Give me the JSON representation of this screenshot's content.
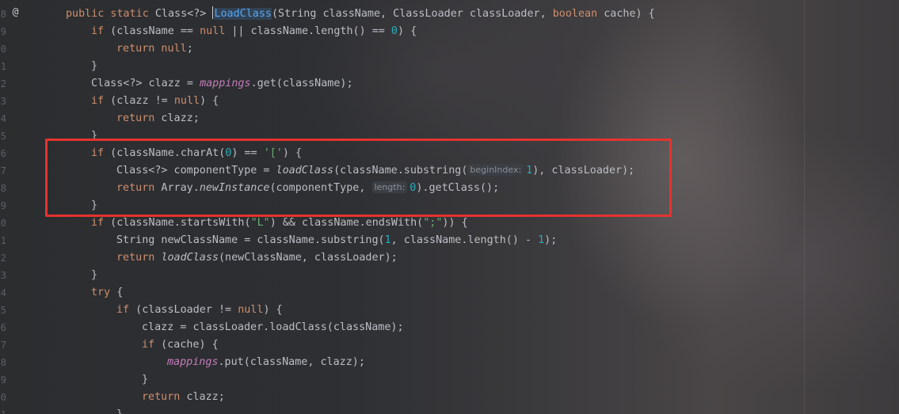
{
  "gutter": {
    "line_numbers": [
      "8",
      "9",
      "0",
      "1",
      "2",
      "3",
      "4",
      "5",
      "6",
      "7",
      "8",
      "9",
      "0",
      "1",
      "2",
      "3",
      "4",
      "5",
      "6",
      "7",
      "8",
      "9",
      "0",
      "1"
    ],
    "marker": "@"
  },
  "code": {
    "l1": {
      "kw1": "public static",
      "t1": " Class<?> ",
      "fn": "LoadClass",
      "t2": "(String className, ClassLoader classLoader, ",
      "kw2": "boolean",
      "t3": " cache) {"
    },
    "l2": {
      "kw1": "if",
      "t1": " (className == ",
      "kw2": "null",
      "t2": " || className.length() == ",
      "n1": "0",
      "t3": ") {"
    },
    "l3": {
      "kw1": "return null",
      "t1": ";"
    },
    "l4": {
      "t1": "}"
    },
    "l5": {
      "t1": "Class<?> clazz = ",
      "f1": "mappings",
      "t2": ".get(className);"
    },
    "l6": {
      "kw1": "if",
      "t1": " (clazz != ",
      "kw2": "null",
      "t2": ") {"
    },
    "l7": {
      "kw1": "return",
      "t1": " clazz;"
    },
    "l8": {
      "t1": "}"
    },
    "l9": {
      "kw1": "if",
      "t1": " (className.charAt(",
      "n1": "0",
      "t2": ") == ",
      "s1": "'['",
      "t3": ") {"
    },
    "l10": {
      "t1": "Class<?> componentType = ",
      "i1": "loadClass",
      "t2": "(className.substring(",
      "h1": "beginIndex:",
      "n1": "1",
      "t3": "), classLoader);"
    },
    "l11": {
      "kw1": "return",
      "t1": " Array.",
      "i1": "newInstance",
      "t2": "(componentType, ",
      "h1": "length:",
      "n1": "0",
      "t3": ").getClass();"
    },
    "l12": {
      "t1": "}"
    },
    "l13": {
      "kw1": "if",
      "t1": " (className.startsWith(",
      "s1": "\"L\"",
      "t2": ") && className.endsWith(",
      "s2": "\";\"",
      "t3": ")) {"
    },
    "l14": {
      "t1": "String newClassName = className.substring(",
      "n1": "1",
      "t2": ", className.length() - ",
      "n2": "1",
      "t3": ");"
    },
    "l15": {
      "kw1": "return",
      "t1": " ",
      "i1": "loadClass",
      "t2": "(newClassName, classLoader);"
    },
    "l16": {
      "t1": "}"
    },
    "l17": {
      "kw1": "try",
      "t1": " {"
    },
    "l18": {
      "kw1": "if",
      "t1": " (classLoader != ",
      "kw2": "null",
      "t2": ") {"
    },
    "l19": {
      "t1": "clazz = classLoader.loadClass(className);"
    },
    "l20": {
      "kw1": "if",
      "t1": " (cache) {"
    },
    "l21": {
      "f1": "mappings",
      "t1": ".put(className, clazz);"
    },
    "l22": {
      "t1": "}"
    },
    "l23": {
      "kw1": "return",
      "t1": " clazz;"
    },
    "l24": {
      "t1": "}"
    }
  },
  "colors": {
    "keyword": "#cf8e6d",
    "method": "#56a8f5",
    "number": "#2aacb8",
    "string": "#6aab73",
    "field": "#c77dbb",
    "text": "#bcbec4",
    "annotation_box": "#e5332e"
  }
}
